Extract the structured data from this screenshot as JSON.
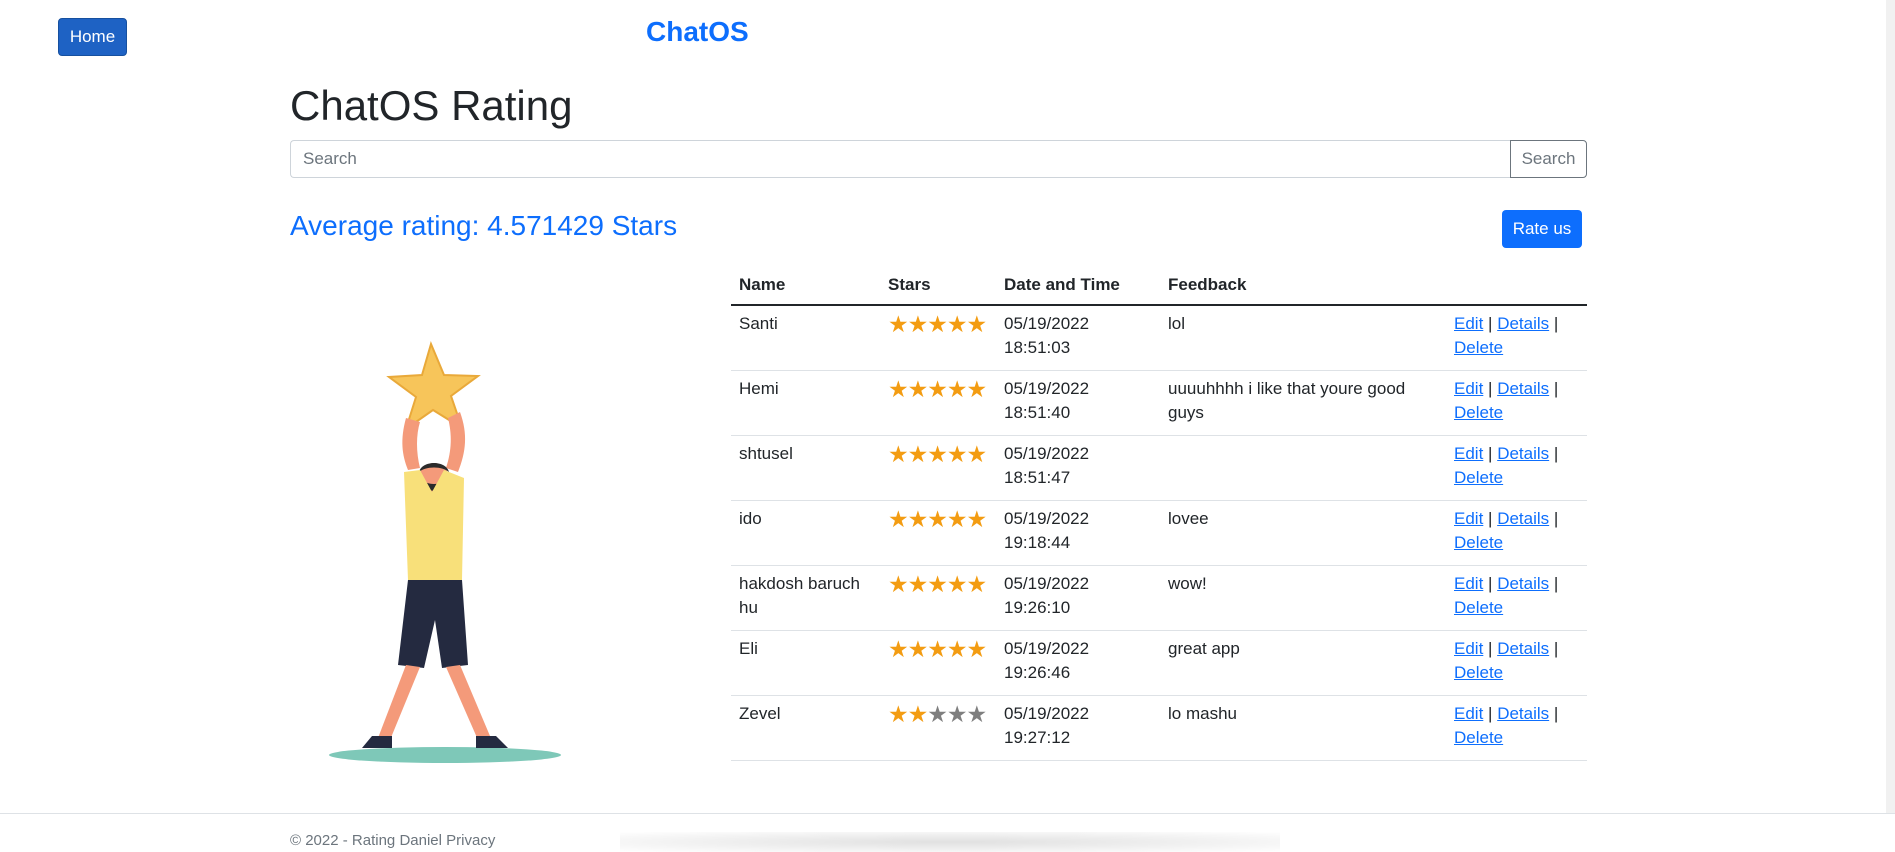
{
  "nav": {
    "home_label": "Home",
    "brand": "ChatOS"
  },
  "page": {
    "title": "ChatOS Rating",
    "search_placeholder": "Search",
    "search_button": "Search",
    "average_label": "Average rating: 4.571429 Stars",
    "rate_button": "Rate us"
  },
  "table": {
    "headers": [
      "Name",
      "Stars",
      "Date and Time",
      "Feedback"
    ],
    "rows": [
      {
        "name": "Santi",
        "stars": 5,
        "datetime": "05/19/2022 18:51:03",
        "feedback": "lol"
      },
      {
        "name": "Hemi",
        "stars": 5,
        "datetime": "05/19/2022 18:51:40",
        "feedback": "uuuuhhhh i like that youre good guys"
      },
      {
        "name": "shtusel",
        "stars": 5,
        "datetime": "05/19/2022 18:51:47",
        "feedback": ""
      },
      {
        "name": "ido",
        "stars": 5,
        "datetime": "05/19/2022 19:18:44",
        "feedback": "lovee"
      },
      {
        "name": "hakdosh baruch hu",
        "stars": 5,
        "datetime": "05/19/2022 19:26:10",
        "feedback": "wow!"
      },
      {
        "name": "Eli",
        "stars": 5,
        "datetime": "05/19/2022 19:26:46",
        "feedback": "great app"
      },
      {
        "name": "Zevel",
        "stars": 2,
        "datetime": "05/19/2022 19:27:12",
        "feedback": "lo mashu"
      }
    ],
    "max_stars": 5,
    "actions": {
      "edit": "Edit",
      "details": "Details",
      "delete": "Delete",
      "separator": "|"
    }
  },
  "footer": {
    "text": "© 2022 - Rating Daniel Privacy"
  },
  "colors": {
    "primary": "#0d6efd",
    "star_filled": "#f39c12",
    "star_empty": "#7f7f7f"
  },
  "icons": {
    "star": "star-icon",
    "illustration": "person-holding-star-illustration"
  }
}
